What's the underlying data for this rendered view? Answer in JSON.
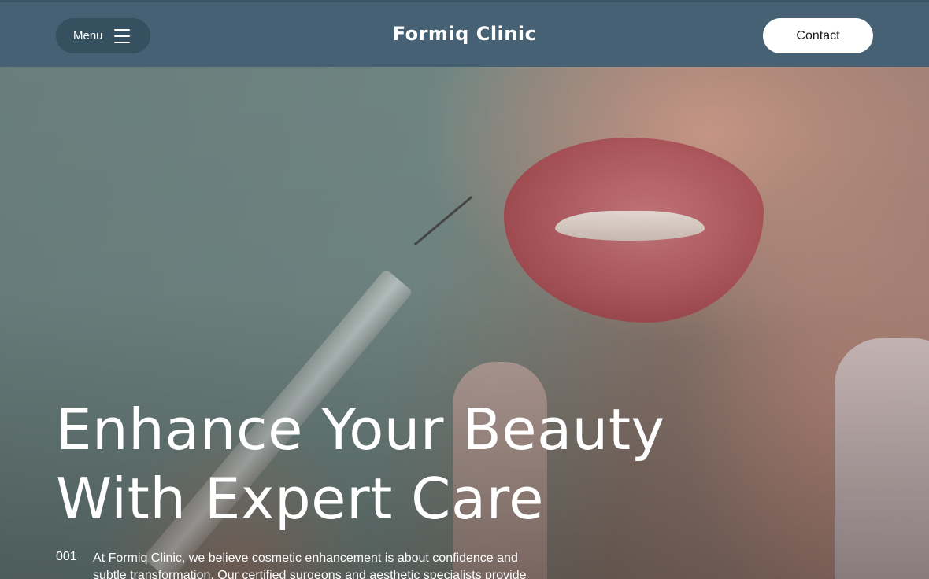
{
  "header": {
    "menu_label": "Menu",
    "brand": "Formiq Clinic",
    "contact_label": "Contact"
  },
  "hero": {
    "headline_line1": "Enhance Your Beauty",
    "headline_line2": "With Expert Care",
    "intro_number": "001",
    "intro_text": "At Formiq Clinic, we believe cosmetic enhancement is about confidence and subtle transformation. Our certified surgeons and aesthetic specialists provide"
  },
  "colors": {
    "navbar": "#456173",
    "menu_pill": "#35505f",
    "contact_button": "#ffffff",
    "text": "#ffffff"
  },
  "icons": {
    "menu": "hamburger-icon"
  }
}
